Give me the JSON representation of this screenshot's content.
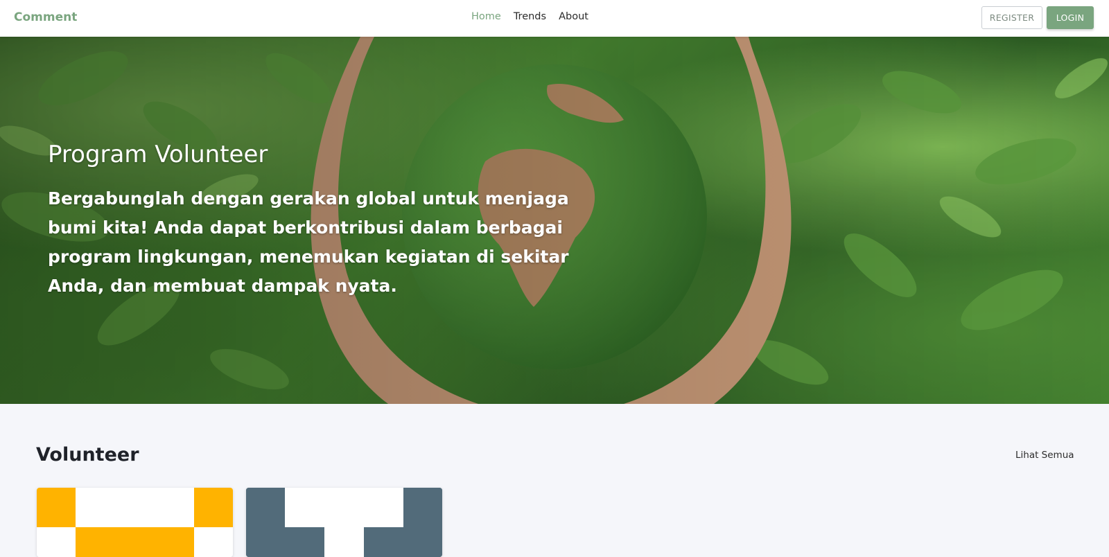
{
  "navbar": {
    "brand": "Comment",
    "links": [
      {
        "label": "Home",
        "active": true
      },
      {
        "label": "Trends",
        "active": false
      },
      {
        "label": "About",
        "active": false
      }
    ],
    "register_label": "REGISTER",
    "login_label": "LOGIN"
  },
  "hero": {
    "title": "Program Volunteer",
    "text": "Bergabunglah dengan gerakan global untuk menjaga bumi kita! Anda dapat berkontribusi dalam berbagai program lingkungan, menemukan kegiatan di sekitar Anda, dan membuat dampak nyata."
  },
  "section": {
    "title": "Volunteer",
    "see_all_label": "Lihat Semua"
  },
  "colors": {
    "accent": "#7aa57f",
    "card1_primary": "#ffb300",
    "card2_primary": "#526b7a",
    "page_background": "#f5f6fa"
  }
}
